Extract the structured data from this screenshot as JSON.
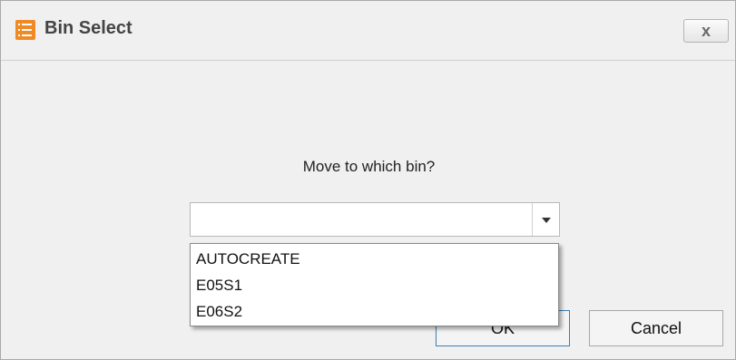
{
  "window": {
    "title": "Bin Select",
    "close_label": "x",
    "icon": "list-icon",
    "icon_color": "#f08a24"
  },
  "dialog": {
    "prompt": "Move to which bin?",
    "combo_value": "",
    "options": [
      "AUTOCREATE",
      "E05S1",
      "E06S2"
    ],
    "ok_label": "OK",
    "cancel_label": "Cancel"
  }
}
